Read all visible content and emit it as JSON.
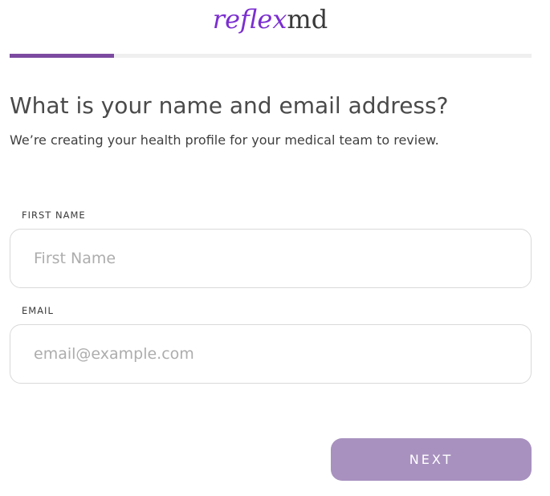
{
  "logo": {
    "part1": "reflex",
    "part2": "md"
  },
  "progress": {
    "fraction": 0.2
  },
  "heading": {
    "title": "What is your name and email address?",
    "subtitle": "We’re creating your health profile for your medical team to review."
  },
  "form": {
    "first_name": {
      "label": "FIRST NAME",
      "placeholder": "First Name",
      "value": ""
    },
    "email": {
      "label": "EMAIL",
      "placeholder": "email@example.com",
      "value": ""
    }
  },
  "next_button": {
    "label": "NEXT"
  },
  "colors": {
    "brand_purple": "#7b2fd0",
    "progress_fill": "#7c4aa0",
    "button_bg": "#a891bf"
  }
}
